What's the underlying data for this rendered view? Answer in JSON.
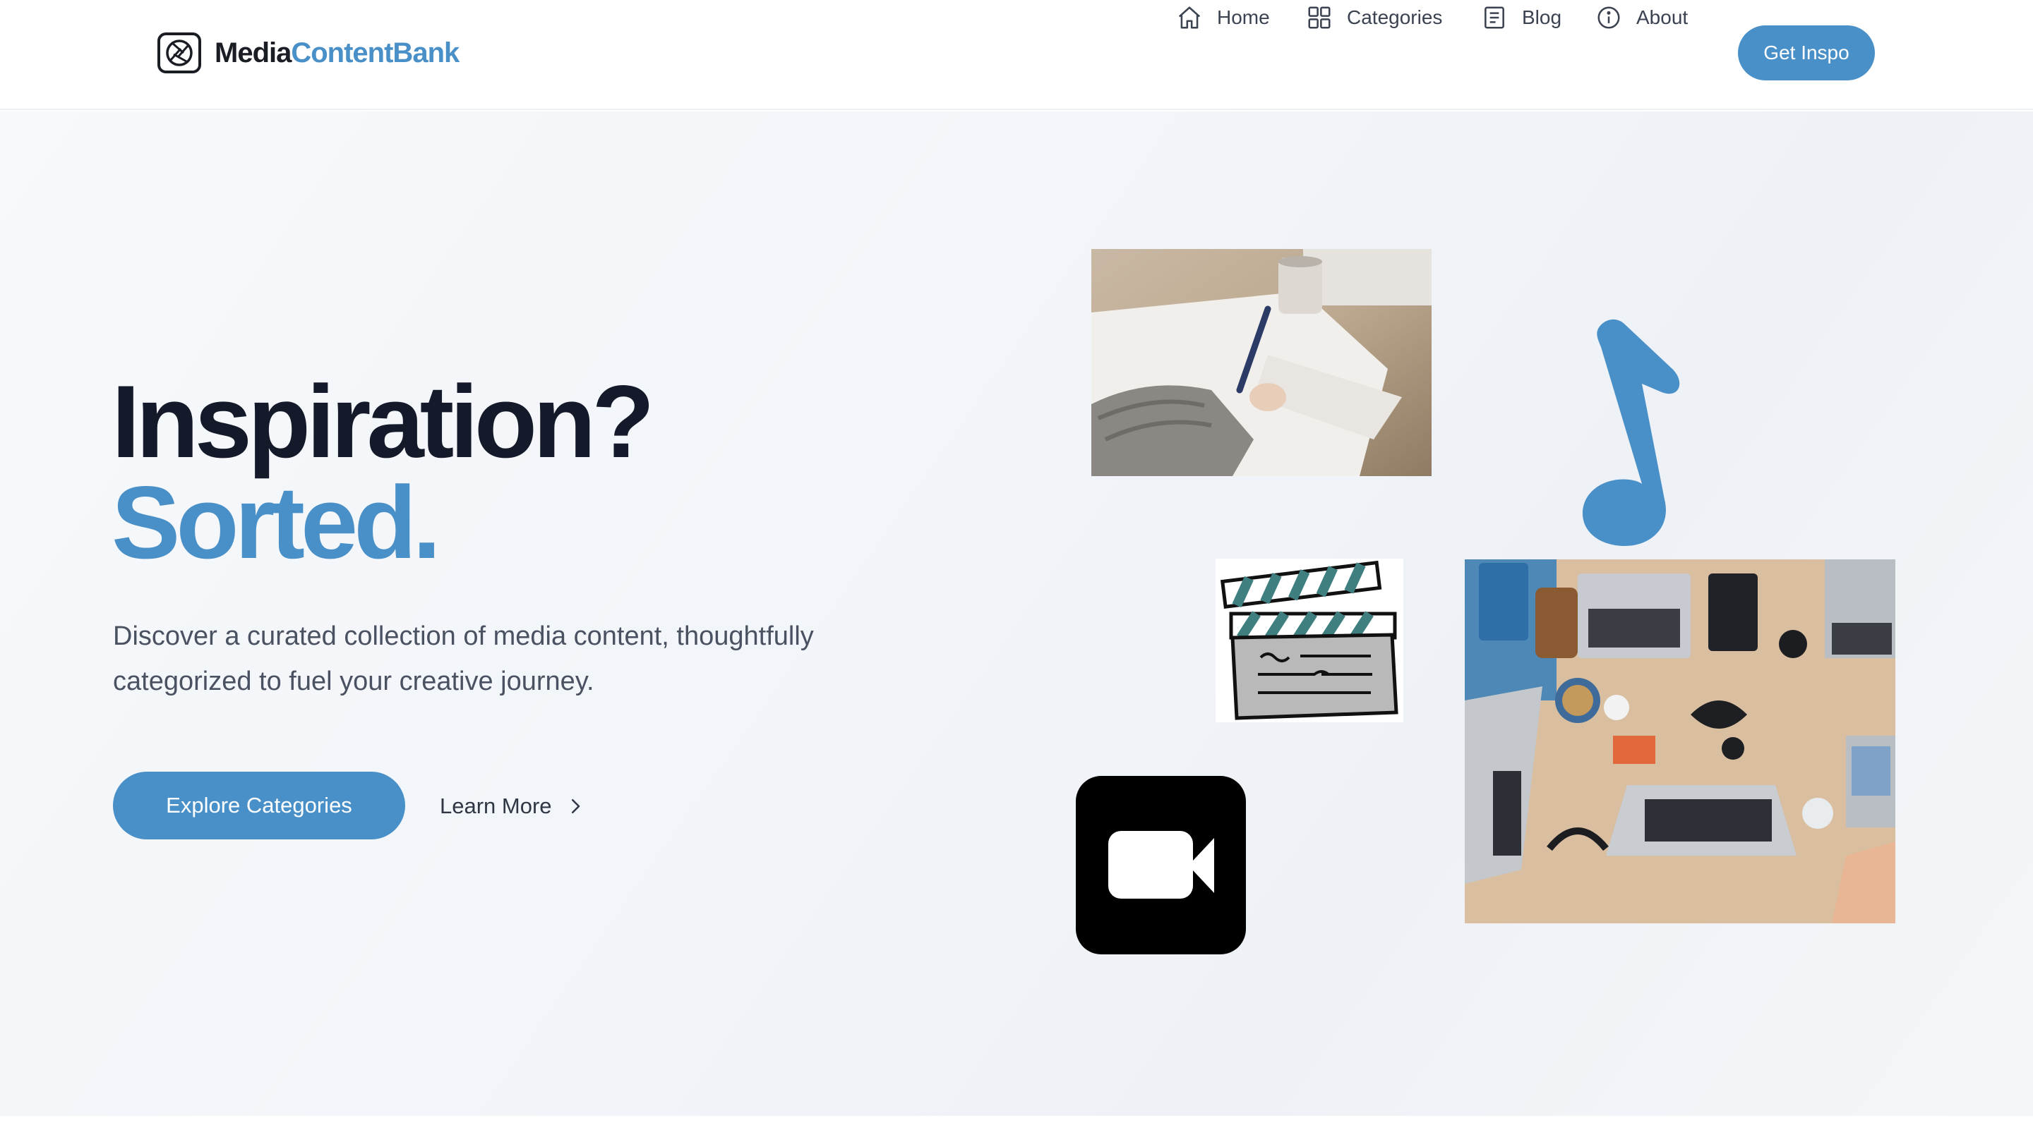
{
  "brand": {
    "part1": "Media",
    "part2": "ContentBank"
  },
  "nav": {
    "items": [
      {
        "label": "Home",
        "icon": "home-icon"
      },
      {
        "label": "Categories",
        "icon": "grid-icon"
      },
      {
        "label": "Blog",
        "icon": "document-icon"
      },
      {
        "label": "About",
        "icon": "info-icon"
      }
    ],
    "cta_label": "Get Inspo"
  },
  "hero": {
    "heading_line1": "Inspiration?",
    "heading_line2": "Sorted.",
    "description": "Discover a curated collection of media content, thoughtfully categorized to fuel your creative journey.",
    "primary_button": "Explore Categories",
    "secondary_link": "Learn More"
  },
  "colors": {
    "accent": "#4a90c8",
    "heading": "#141a29",
    "body_text": "#4a5262"
  },
  "media_tiles": [
    {
      "name": "writing-photo",
      "kind": "photo"
    },
    {
      "name": "music-note-icon",
      "kind": "icon"
    },
    {
      "name": "clapperboard-illustration",
      "kind": "illustration"
    },
    {
      "name": "desk-laptops-photo",
      "kind": "photo"
    },
    {
      "name": "video-camera-icon",
      "kind": "icon"
    }
  ]
}
